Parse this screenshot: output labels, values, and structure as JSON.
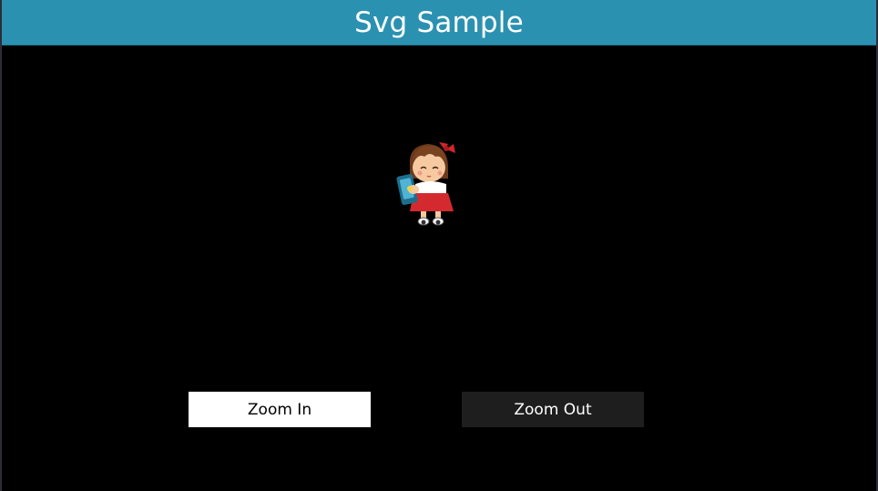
{
  "app": {
    "title": "Svg Sample"
  },
  "image": {
    "icon": "girl-holding-phone-icon"
  },
  "controls": {
    "zoom_in_label": "Zoom In",
    "zoom_out_label": "Zoom Out"
  },
  "colors": {
    "title_bar": "#2b91b1",
    "background": "#000000",
    "zoom_in_bg": "#ffffff",
    "zoom_out_bg": "#1e1e1e"
  }
}
